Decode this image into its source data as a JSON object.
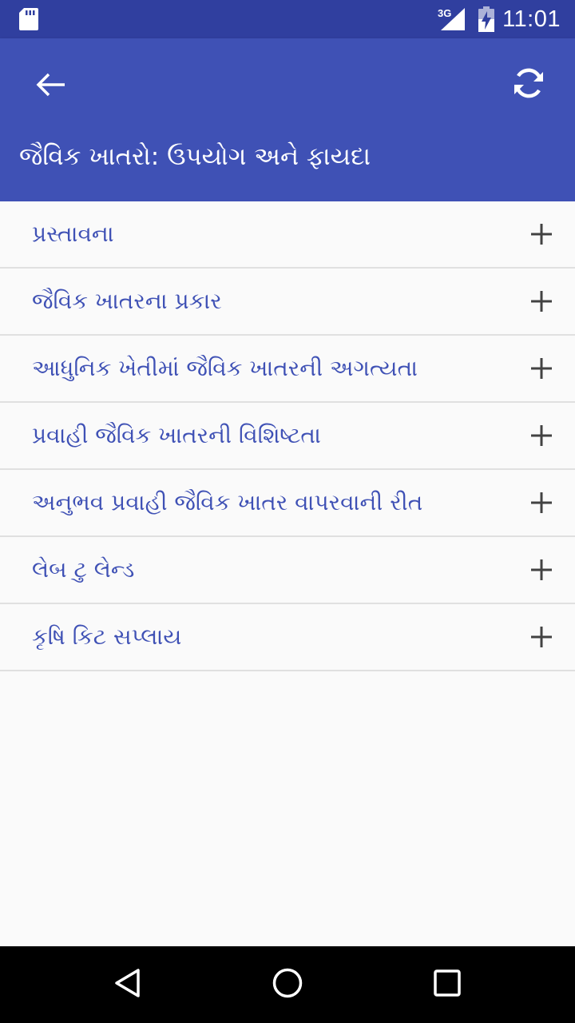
{
  "status_bar": {
    "time": "11:01",
    "network": "3G",
    "icons": [
      "sd-card-icon",
      "signal-icon",
      "battery-charging-icon"
    ]
  },
  "app_bar": {
    "title": "જૈવિક ખાતરો: ઉપયોગ અને ફાયદા",
    "back_icon": "arrow-back-icon",
    "refresh_icon": "refresh-icon"
  },
  "list": {
    "items": [
      {
        "label": "પ્રસ્તાવના"
      },
      {
        "label": "જૈવિક ખાતરના પ્રકાર"
      },
      {
        "label": "આધુનિક ખેતીમાં જૈવિક ખાતરની અગત્યતા"
      },
      {
        "label": "પ્રવાહી જૈવિક ખાતરની વિશિષ્ટતા"
      },
      {
        "label": "અનુભવ પ્રવાહી જૈવિક ખાતર વાપરવાની રીત"
      },
      {
        "label": "લેબ ટુ લેન્ડ"
      },
      {
        "label": "કૃષિ કિટ સપ્લાય"
      }
    ],
    "expand_icon": "plus-icon"
  },
  "colors": {
    "status_bar": "#303f9f",
    "app_bar": "#3f51b5",
    "item_text": "#3f51b5",
    "background": "#fafafa"
  },
  "nav_bar": {
    "icons": [
      "back-triangle-icon",
      "home-circle-icon",
      "recents-square-icon"
    ]
  }
}
